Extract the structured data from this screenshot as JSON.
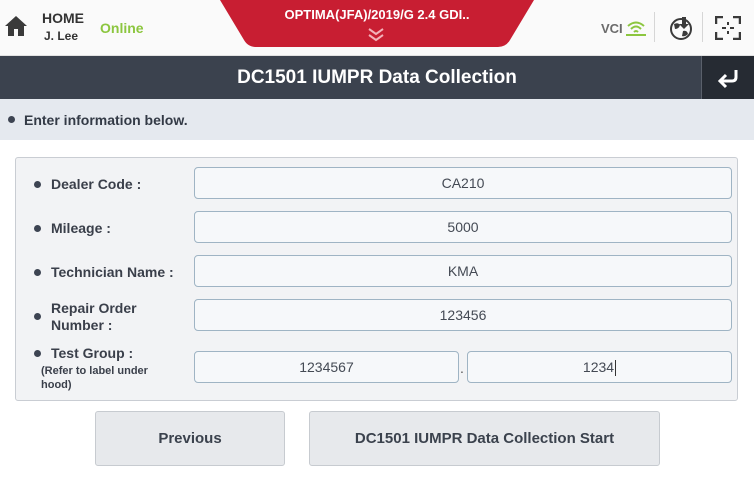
{
  "header": {
    "home_label": "HOME",
    "user_name": "J. Lee",
    "connection_status": "Online",
    "vehicle": "OPTIMA(JFA)/2019/G 2.4 GDI..",
    "vci_label": "VCI",
    "icons": [
      "home-icon",
      "chevron-down-icon",
      "wifi-icon",
      "globe-download-icon",
      "fullscreen-icon"
    ]
  },
  "title": {
    "text": "DC1501 IUMPR Data Collection",
    "back_icon": "return-arrow-icon"
  },
  "info": {
    "text": "Enter information below."
  },
  "form": {
    "dealer_code": {
      "label": "Dealer Code :",
      "value": "CA210"
    },
    "mileage": {
      "label": "Mileage :",
      "value": "5000"
    },
    "technician_name": {
      "label": "Technician Name :",
      "value": "KMA"
    },
    "repair_order": {
      "label_line1": "Repair Order",
      "label_line2": "Number :",
      "value": "123456"
    },
    "test_group": {
      "label": "Test Group :",
      "note_line1": "(Refer to label under",
      "note_line2": "hood)",
      "value_part1": "1234567",
      "separator": ".",
      "value_part2": "1234"
    }
  },
  "buttons": {
    "previous": "Previous",
    "start": "DC1501 IUMPR Data Collection Start"
  },
  "colors": {
    "accent_red": "#c81e32",
    "online_green": "#8cc63f",
    "titlebar": "#3b424e",
    "info_bg": "#e5e9ef"
  }
}
